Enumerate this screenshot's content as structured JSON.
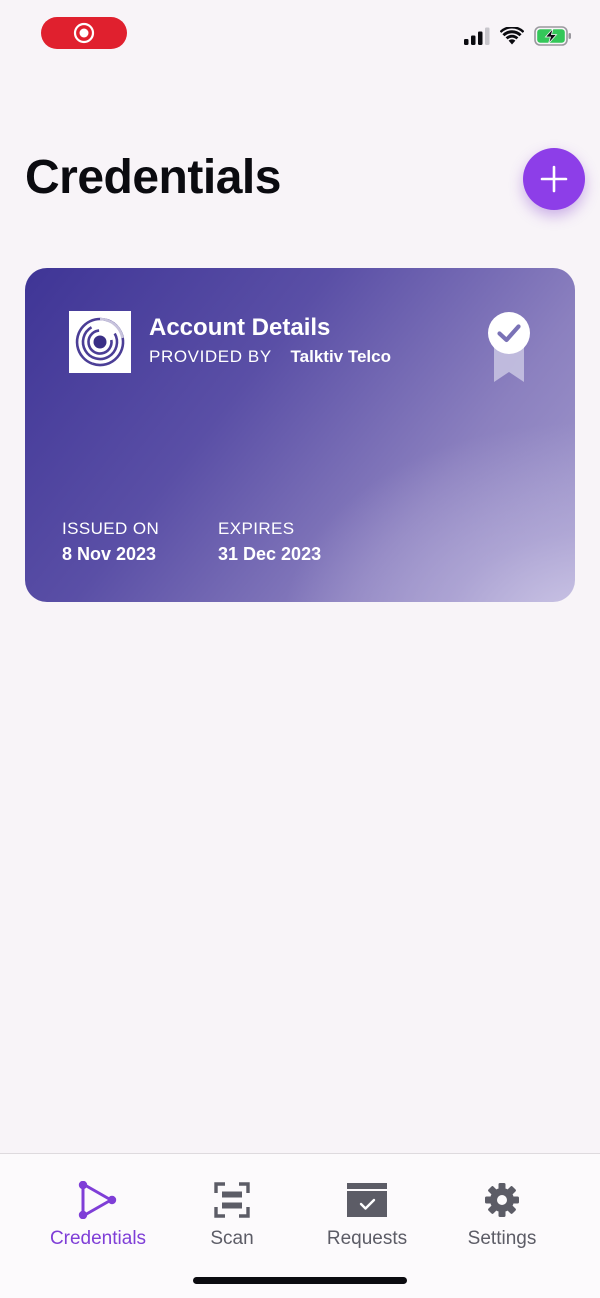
{
  "status_bar": {
    "record_icon": "screen-record-icon",
    "signal_icon": "cellular-signal-icon",
    "wifi_icon": "wifi-icon",
    "battery_icon": "battery-charging-icon"
  },
  "header": {
    "title": "Credentials",
    "add_icon": "plus-icon"
  },
  "credentials": [
    {
      "title": "Account Details",
      "provided_by_label": "PROVIDED BY",
      "provider": "Talktiv Telco",
      "issued_label": "ISSUED ON",
      "issued_date": "8 Nov 2023",
      "expires_label": "EXPIRES",
      "expires_date": "31 Dec 2023",
      "badge_icon": "verified-ribbon-icon",
      "logo_icon": "concentric-circles-logo"
    }
  ],
  "tab_bar": {
    "active": "Credentials",
    "tabs": [
      {
        "label": "Credentials",
        "icon": "credentials-icon"
      },
      {
        "label": "Scan",
        "icon": "scan-icon"
      },
      {
        "label": "Requests",
        "icon": "requests-icon"
      },
      {
        "label": "Settings",
        "icon": "gear-icon"
      }
    ]
  },
  "colors": {
    "accent": "#8d3ee8",
    "active_tab": "#7f3ed7",
    "inactive_tab": "#5c5c66",
    "card_start": "#3f3596",
    "card_end": "#a59dcf",
    "background": "#f8f4f8",
    "record_pill": "#e0202e",
    "battery_charging": "#34c759"
  }
}
